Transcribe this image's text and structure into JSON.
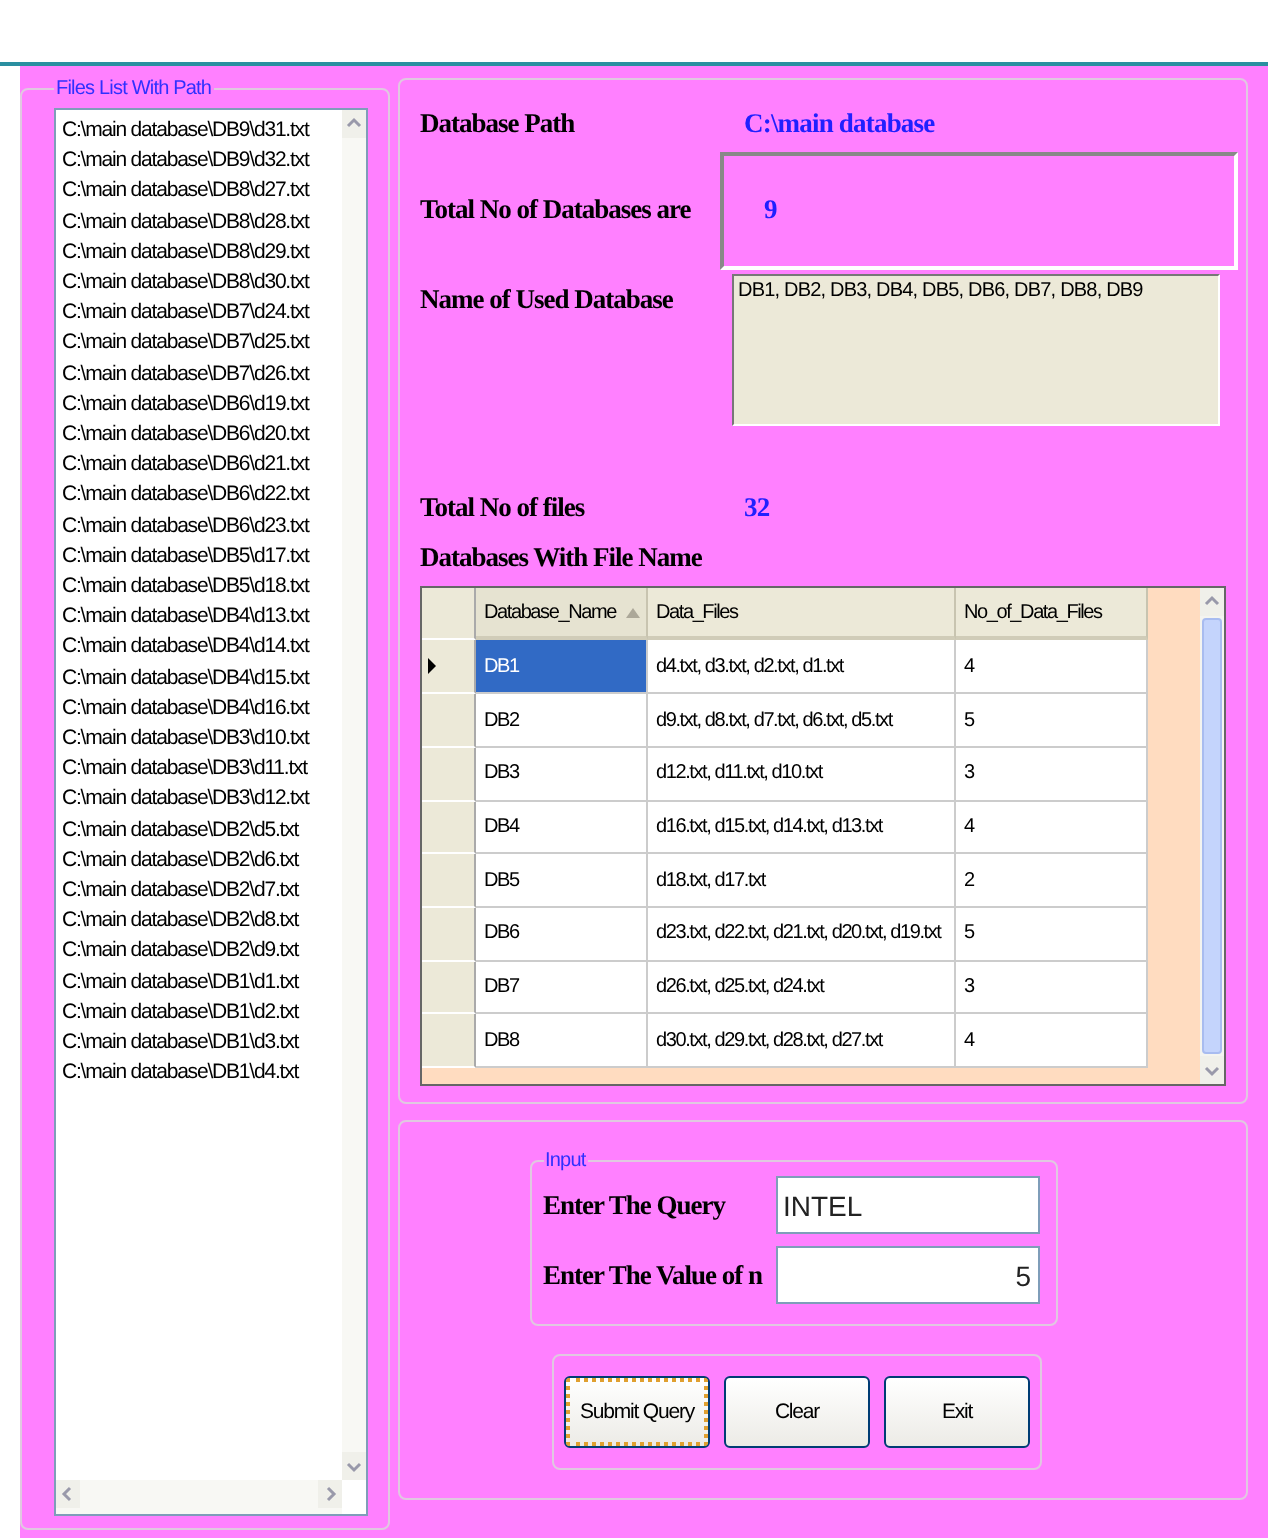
{
  "files_panel": {
    "title": "Files List With Path",
    "items": [
      "C:\\main database\\DB9\\d31.txt",
      "C:\\main database\\DB9\\d32.txt",
      "C:\\main database\\DB8\\d27.txt",
      "C:\\main database\\DB8\\d28.txt",
      "C:\\main database\\DB8\\d29.txt",
      "C:\\main database\\DB8\\d30.txt",
      "C:\\main database\\DB7\\d24.txt",
      "C:\\main database\\DB7\\d25.txt",
      "C:\\main database\\DB7\\d26.txt",
      "C:\\main database\\DB6\\d19.txt",
      "C:\\main database\\DB6\\d20.txt",
      "C:\\main database\\DB6\\d21.txt",
      "C:\\main database\\DB6\\d22.txt",
      "C:\\main database\\DB6\\d23.txt",
      "C:\\main database\\DB5\\d17.txt",
      "C:\\main database\\DB5\\d18.txt",
      "C:\\main database\\DB4\\d13.txt",
      "C:\\main database\\DB4\\d14.txt",
      "C:\\main database\\DB4\\d15.txt",
      "C:\\main database\\DB4\\d16.txt",
      "C:\\main database\\DB3\\d10.txt",
      "C:\\main database\\DB3\\d11.txt",
      "C:\\main database\\DB3\\d12.txt",
      "C:\\main database\\DB2\\d5.txt",
      "C:\\main database\\DB2\\d6.txt",
      "C:\\main database\\DB2\\d7.txt",
      "C:\\main database\\DB2\\d8.txt",
      "C:\\main database\\DB2\\d9.txt",
      "C:\\main database\\DB1\\d1.txt",
      "C:\\main database\\DB1\\d2.txt",
      "C:\\main database\\DB1\\d3.txt",
      "C:\\main database\\DB1\\d4.txt"
    ]
  },
  "summary": {
    "path_label": "Database Path",
    "path_value": "C:\\main database",
    "db_count_label": "Total No of Databases are",
    "db_count_value": "9",
    "used_label": "Name of Used Database",
    "used_value": "DB1, DB2, DB3, DB4, DB5, DB6, DB7, DB8, DB9",
    "files_label": "Total No of  files",
    "files_value": "32",
    "grid_title": "Databases With File Name"
  },
  "grid": {
    "columns": [
      {
        "label": "Database_Name",
        "sorted": true
      },
      {
        "label": "Data_Files",
        "sorted": false
      },
      {
        "label": "No_of_Data_Files",
        "sorted": false
      }
    ],
    "rows": [
      {
        "cells": [
          "DB1",
          "d4.txt, d3.txt, d2.txt, d1.txt",
          "4"
        ],
        "selected": true
      },
      {
        "cells": [
          "DB2",
          "d9.txt, d8.txt, d7.txt, d6.txt, d5.txt",
          "5"
        ],
        "selected": false
      },
      {
        "cells": [
          "DB3",
          "d12.txt, d11.txt, d10.txt",
          "3"
        ],
        "selected": false
      },
      {
        "cells": [
          "DB4",
          "d16.txt, d15.txt, d14.txt, d13.txt",
          "4"
        ],
        "selected": false
      },
      {
        "cells": [
          "DB5",
          "d18.txt, d17.txt",
          "2"
        ],
        "selected": false
      },
      {
        "cells": [
          "DB6",
          "d23.txt, d22.txt, d21.txt, d20.txt, d19.txt",
          "5"
        ],
        "selected": false
      },
      {
        "cells": [
          "DB7",
          "d26.txt, d25.txt, d24.txt",
          "3"
        ],
        "selected": false
      },
      {
        "cells": [
          "DB8",
          "d30.txt, d29.txt, d28.txt, d27.txt",
          "4"
        ],
        "selected": false
      }
    ]
  },
  "input": {
    "title": "Input",
    "fields": [
      {
        "label": "Enter The Query",
        "value": "INTEL",
        "kind": "text"
      },
      {
        "label": "Enter The Value of n",
        "value": "5",
        "kind": "number"
      }
    ]
  },
  "buttons": [
    {
      "label": "Submit Query",
      "focused": true
    },
    {
      "label": "Clear",
      "focused": false
    },
    {
      "label": "Exit",
      "focused": false
    }
  ]
}
